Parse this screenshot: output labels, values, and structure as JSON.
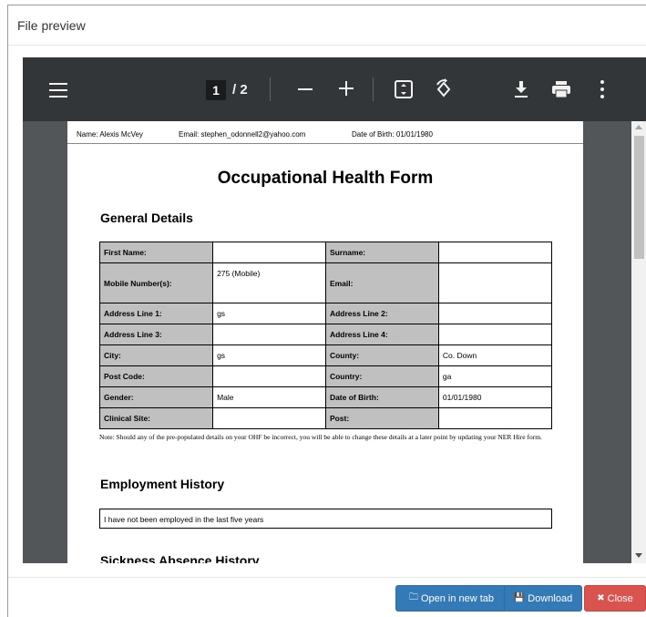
{
  "modal": {
    "title": "File preview"
  },
  "viewer": {
    "current_page": "1",
    "total_pages": "/ 2"
  },
  "document": {
    "header": {
      "name": "Name: Alexis McVey",
      "email": "Email: stephen_odonnell2@yahoo.com",
      "dob": "Date of Birth: 01/01/1980"
    },
    "title": "Occupational Health Form",
    "general_details_heading": "General Details",
    "rows": [
      {
        "l1": "First Name:",
        "v1": "",
        "l2": "Surname:",
        "v2": ""
      },
      {
        "l1": "Mobile Number(s):",
        "v1": "275 (Mobile)",
        "l2": "Email:",
        "v2": ""
      },
      {
        "l1": "Address Line 1:",
        "v1": "gs",
        "l2": "Address Line 2:",
        "v2": ""
      },
      {
        "l1": "Address Line 3:",
        "v1": "",
        "l2": "Address Line 4:",
        "v2": ""
      },
      {
        "l1": "City:",
        "v1": "gs",
        "l2": "County:",
        "v2": "Co. Down"
      },
      {
        "l1": "Post Code:",
        "v1": "",
        "l2": "Country:",
        "v2": "ga"
      },
      {
        "l1": "Gender:",
        "v1": "Male",
        "l2": "Date of Birth:",
        "v2": "01/01/1980"
      },
      {
        "l1": "Clinical Site:",
        "v1": "",
        "l2": "Post:",
        "v2": ""
      }
    ],
    "note": "Note: Should any of the pre-populated details on your OHF be incorrect, you will be able to change these details at a later point by updating your NER Hire form.",
    "employment_heading": "Employment History",
    "employment_text": "I have not been employed in the last five years",
    "next_heading": "Sickness Absence History"
  },
  "footer": {
    "open_label": "Open in new tab",
    "download_label": "Download",
    "close_label": "Close"
  }
}
